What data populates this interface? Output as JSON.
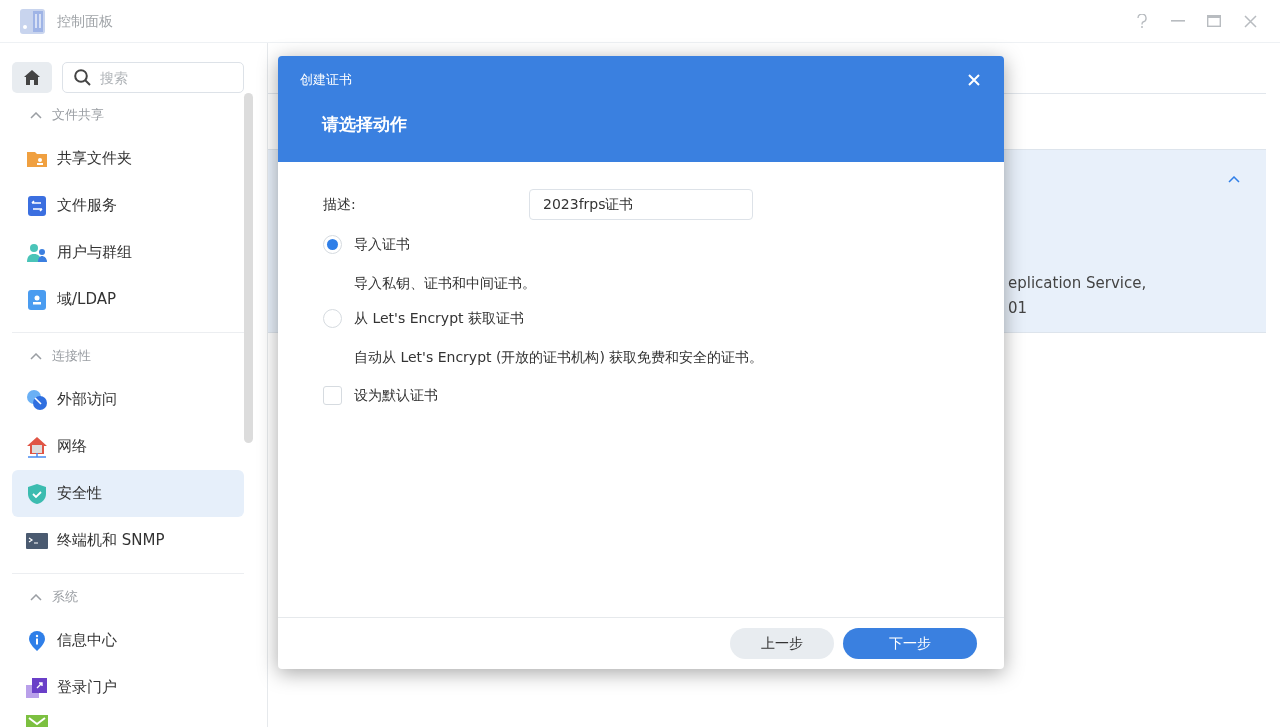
{
  "window": {
    "title": "控制面板"
  },
  "sidebar": {
    "search": {
      "placeholder": "搜索"
    },
    "sections": [
      {
        "title": "文件共享",
        "expanded": true,
        "items": [
          {
            "label": "共享文件夹",
            "kind": "folder",
            "selected": false
          },
          {
            "label": "文件服务",
            "kind": "fileservice",
            "selected": false
          },
          {
            "label": "用户与群组",
            "kind": "users",
            "selected": false
          },
          {
            "label": "域/LDAP",
            "kind": "ldap",
            "selected": false
          }
        ]
      },
      {
        "title": "连接性",
        "expanded": true,
        "items": [
          {
            "label": "外部访问",
            "kind": "external",
            "selected": false
          },
          {
            "label": "网络",
            "kind": "network",
            "selected": false
          },
          {
            "label": "安全性",
            "kind": "security",
            "selected": true
          },
          {
            "label": "终端机和 SNMP",
            "kind": "terminal",
            "selected": false
          }
        ]
      },
      {
        "title": "系统",
        "expanded": true,
        "items": [
          {
            "label": "信息中心",
            "kind": "info",
            "selected": false
          },
          {
            "label": "登录门户",
            "kind": "portal",
            "selected": false
          }
        ]
      }
    ]
  },
  "background_panel": {
    "expanded": true,
    "lines": [
      "eplication Service,",
      "01"
    ]
  },
  "dialog": {
    "title": "创建证书",
    "heading": "请选择动作",
    "description": {
      "label": "描述:",
      "value": "2023frps证书"
    },
    "options": [
      {
        "label": "导入证书",
        "hint": "导入私钥、证书和中间证书。",
        "selected": true
      },
      {
        "label": "从 Let's Encrypt 获取证书",
        "hint": "自动从 Let's Encrypt (开放的证书机构) 获取免费和安全的证书。",
        "selected": false
      }
    ],
    "default_checkbox": {
      "label": "设为默认证书",
      "checked": false
    },
    "buttons": {
      "back": "上一步",
      "next": "下一步"
    }
  }
}
